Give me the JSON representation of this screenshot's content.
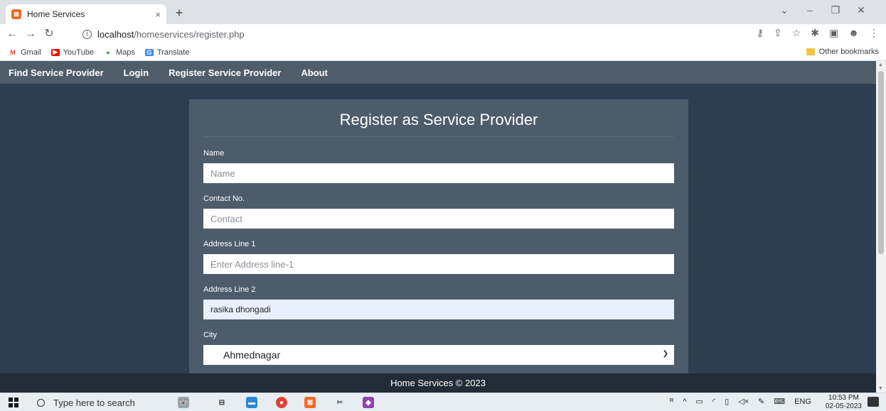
{
  "browser": {
    "tab_title": "Home Services",
    "tab_close": "×",
    "new_tab": "+",
    "url_host": "localhost",
    "url_path": "/homeservices/register.php",
    "bookmarks": [
      {
        "label": "Gmail",
        "icon": "gmail-icon",
        "color": "#ea4335"
      },
      {
        "label": "YouTube",
        "icon": "youtube-icon",
        "color": "#ff0000"
      },
      {
        "label": "Maps",
        "icon": "maps-icon",
        "color": "#34a853"
      },
      {
        "label": "Translate",
        "icon": "translate-icon",
        "color": "#4285f4"
      }
    ],
    "other_bookmarks": "Other bookmarks"
  },
  "nav": {
    "items": [
      "Find Service Provider",
      "Login",
      "Register Service Provider",
      "About"
    ]
  },
  "form": {
    "title": "Register as Service Provider",
    "name_label": "Name",
    "name_placeholder": "Name",
    "contact_label": "Contact No.",
    "contact_placeholder": "Contact",
    "address1_label": "Address Line 1",
    "address1_placeholder": "Enter Address line-1",
    "address2_label": "Address Line 2",
    "address2_value": "rasika dhongadi",
    "city_label": "City",
    "city_value": "Ahmednagar"
  },
  "footer": {
    "text": "Home Services © 2023"
  },
  "taskbar": {
    "search_placeholder": "Type here to search",
    "language": "ENG",
    "time": "10:53 PM",
    "date": "02-05-2023"
  },
  "colors": {
    "page_bg": "#2c3e50",
    "navbar_bg": "#4f5d6b",
    "card_bg": "#4c5c6b",
    "footer_bg": "#222c36"
  }
}
